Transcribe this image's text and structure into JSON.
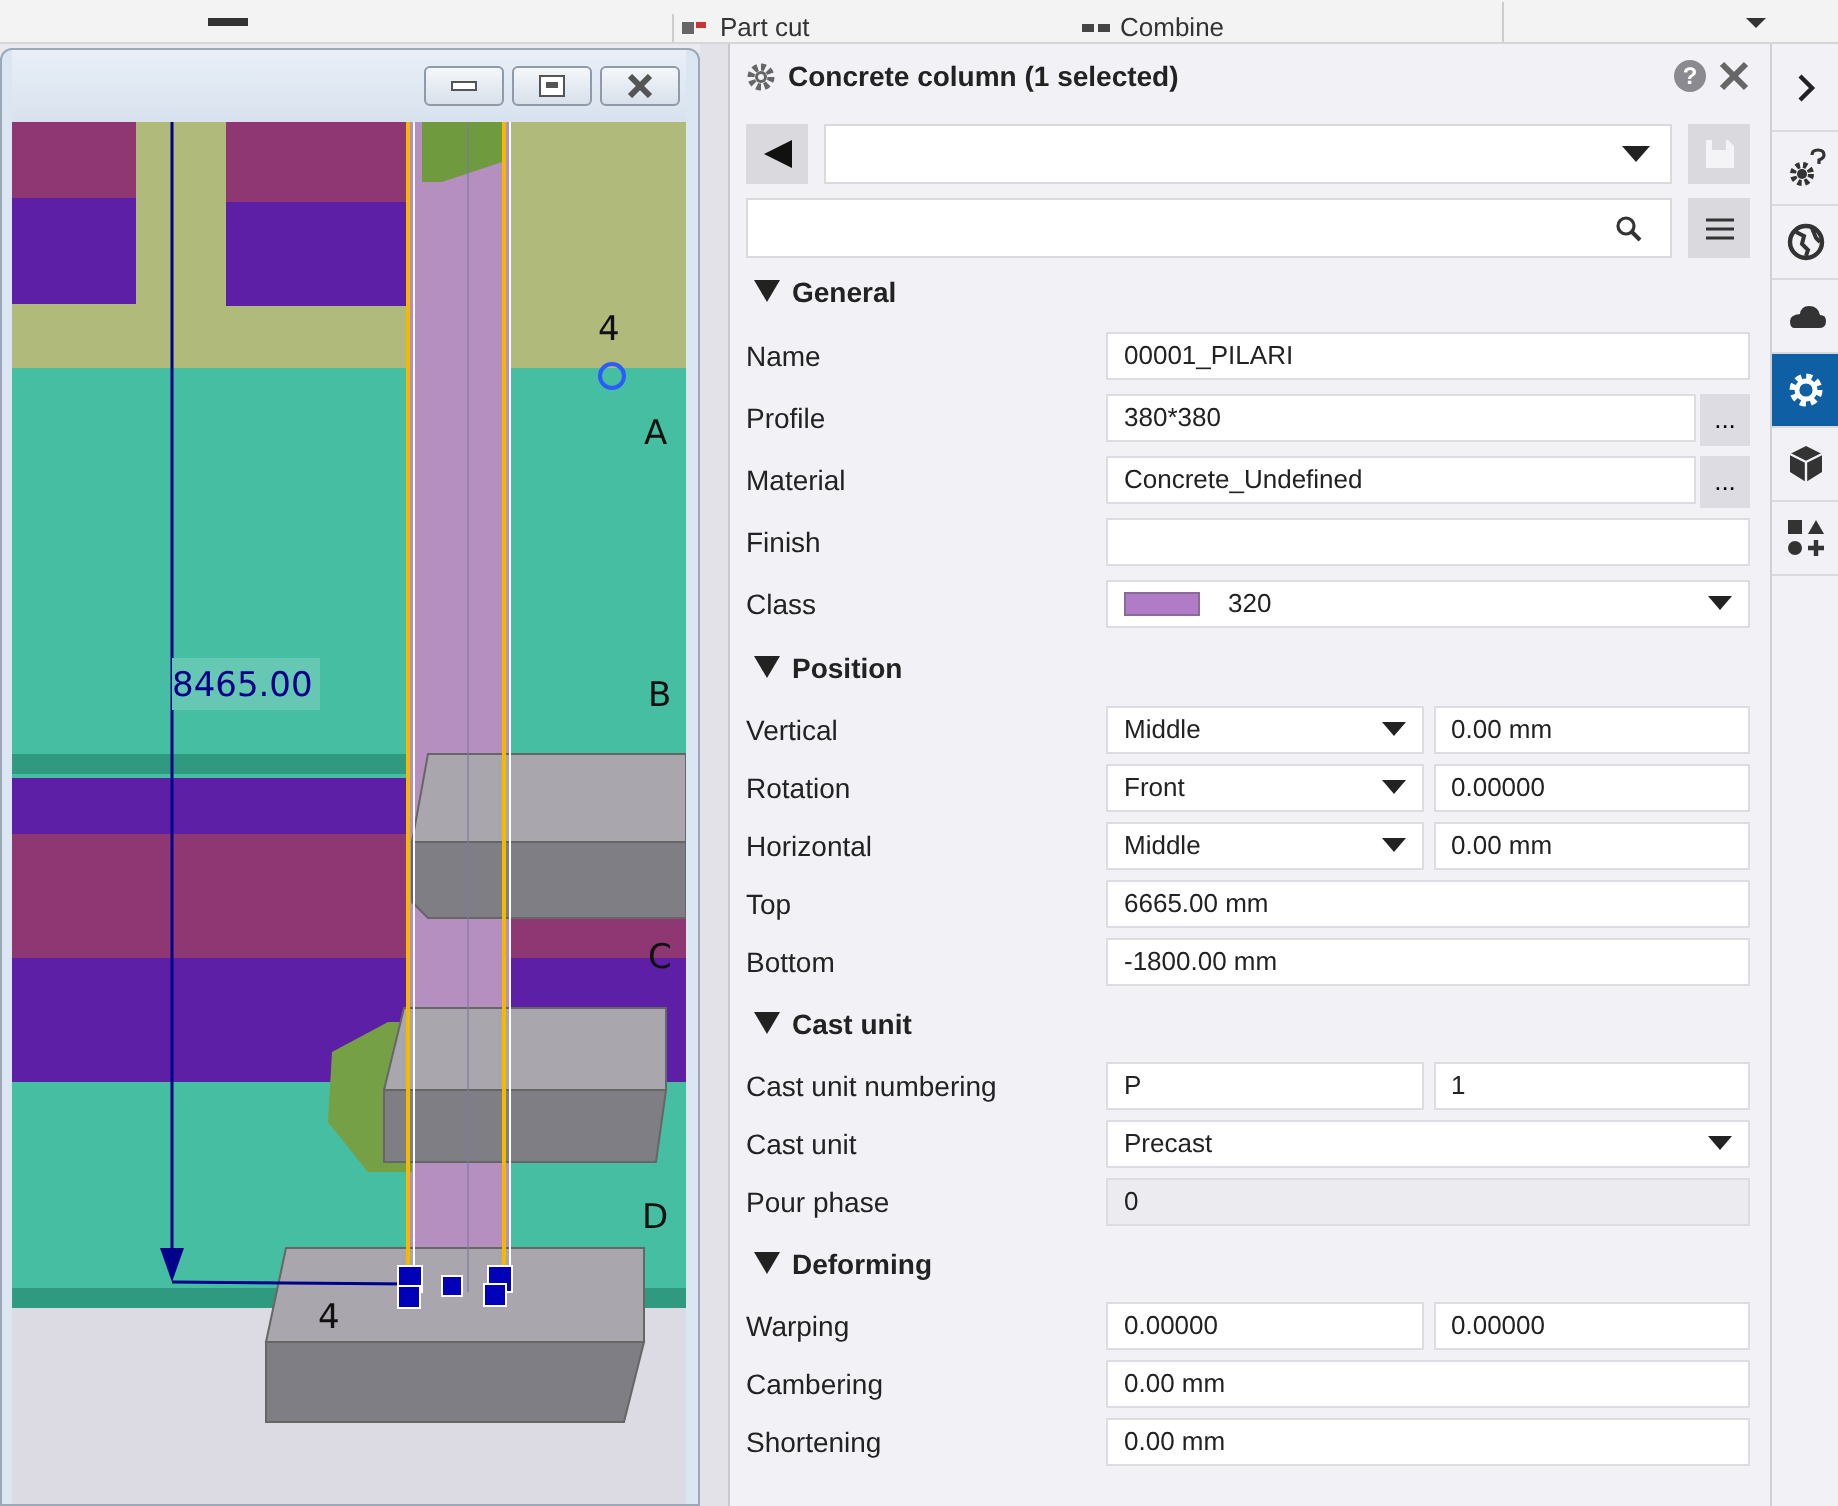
{
  "toolbar": {
    "items": [
      {
        "label": "Part cut"
      },
      {
        "label": "Combine"
      }
    ]
  },
  "model_view": {
    "grid_labels": [
      "4",
      "A",
      "B",
      "C",
      "D"
    ],
    "dimension": "8465.00",
    "part_label": "4"
  },
  "properties": {
    "title": "Concrete column (1 selected)",
    "help": "?",
    "sections": [
      {
        "title": "General",
        "expanded": true,
        "rows": [
          {
            "label": "Name",
            "kind": "text",
            "value": "00001_PILARI"
          },
          {
            "label": "Profile",
            "kind": "browse",
            "value": "380*380",
            "button": "..."
          },
          {
            "label": "Material",
            "kind": "browse",
            "value": "Concrete_Undefined",
            "button": "..."
          },
          {
            "label": "Finish",
            "kind": "text"
          },
          {
            "label": "Class",
            "kind": "class",
            "value": "320",
            "color": "#b07cc6"
          }
        ]
      },
      {
        "title": "Position",
        "expanded": true,
        "rows": [
          {
            "label": "Vertical",
            "kind": "dropdown_text",
            "value": "Middle",
            "value2": "0.00 mm"
          },
          {
            "label": "Rotation",
            "kind": "dropdown_text",
            "value": "Front",
            "value2": "0.00000"
          },
          {
            "label": "Horizontal",
            "kind": "dropdown_text",
            "value": "Middle",
            "value2": "0.00 mm"
          },
          {
            "label": "Top",
            "kind": "text",
            "value": "6665.00 mm"
          },
          {
            "label": "Bottom",
            "kind": "text",
            "value": "-1800.00 mm"
          }
        ]
      },
      {
        "title": "Cast unit",
        "expanded": true,
        "rows": [
          {
            "label": "Cast unit numbering",
            "kind": "pair",
            "value": "P",
            "value2": "1"
          },
          {
            "label": "Cast unit",
            "kind": "dropdown",
            "value": "Precast"
          },
          {
            "label": "Pour phase",
            "kind": "readonly",
            "value": "0"
          }
        ]
      },
      {
        "title": "Deforming",
        "expanded": true,
        "rows": [
          {
            "label": "Warping",
            "kind": "pair",
            "value": "0.00000",
            "value2": "0.00000"
          },
          {
            "label": "Cambering",
            "kind": "text",
            "value": "0.00 mm"
          },
          {
            "label": "Shortening",
            "kind": "text",
            "value": "0.00 mm"
          }
        ]
      }
    ]
  },
  "side_tabs": [
    {
      "kind": "gear_question",
      "selected": false
    },
    {
      "kind": "globe",
      "selected": false
    },
    {
      "kind": "cloud",
      "selected": false
    },
    {
      "kind": "gear",
      "selected": true
    },
    {
      "kind": "cube",
      "selected": false
    },
    {
      "kind": "shapes",
      "selected": false
    }
  ]
}
